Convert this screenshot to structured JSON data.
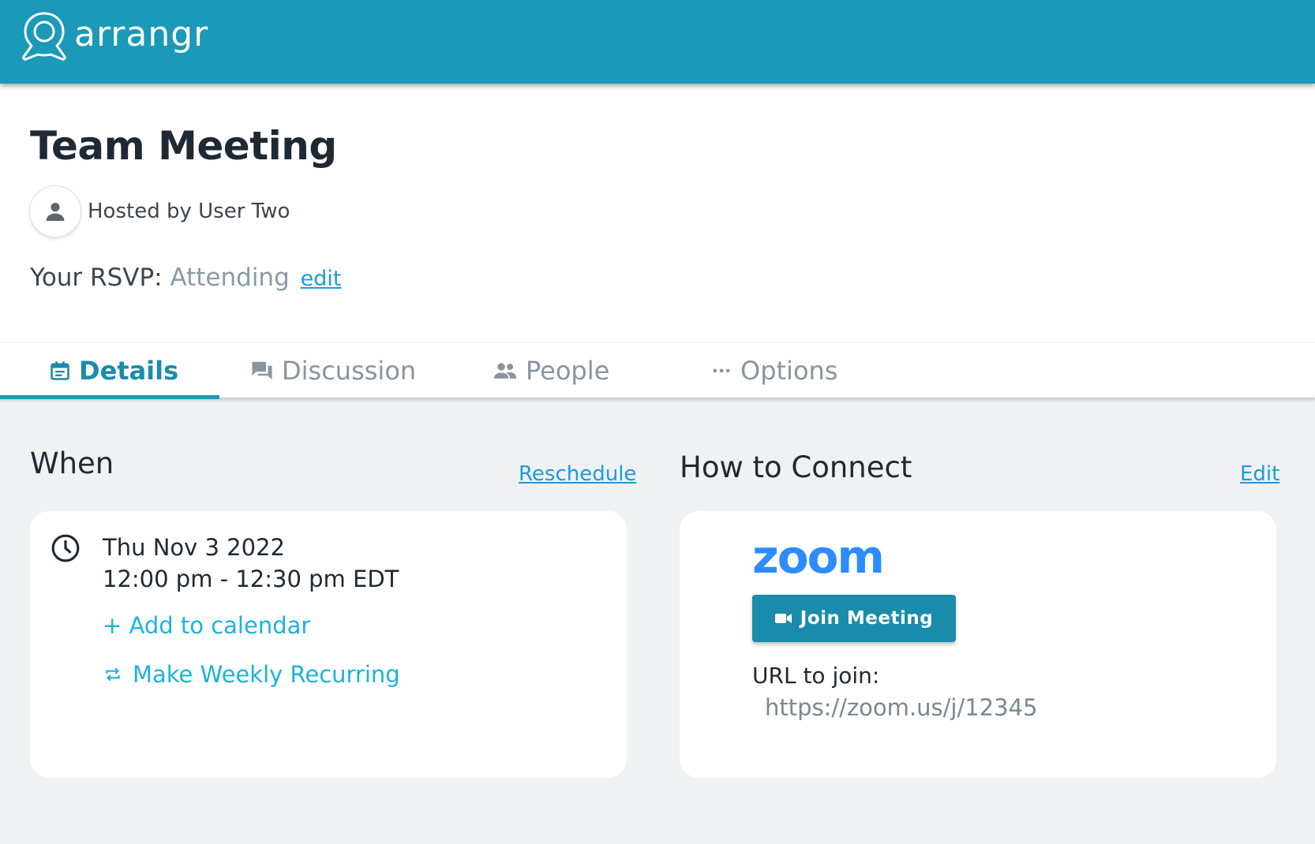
{
  "header": {
    "brand": "arrangr",
    "background": "#1a99b8"
  },
  "event": {
    "title": "Team Meeting",
    "host_text": "Hosted by User Two",
    "rsvp_label": "Your RSVP:",
    "rsvp_status": "Attending",
    "rsvp_edit": "edit"
  },
  "tabs": [
    {
      "label": "Details",
      "icon": "calendar-icon",
      "active": true
    },
    {
      "label": "Discussion",
      "icon": "chat-icon",
      "active": false
    },
    {
      "label": "People",
      "icon": "people-icon",
      "active": false
    },
    {
      "label": "Options",
      "icon": "more-horizontal-icon",
      "active": false
    }
  ],
  "when": {
    "title": "When",
    "action": "Reschedule",
    "date": "Thu Nov 3 2022",
    "time": "12:00 pm - 12:30 pm EDT",
    "add_calendar": "+ Add to calendar",
    "recurring": "Make Weekly Recurring"
  },
  "connect": {
    "title": "How to Connect",
    "action": "Edit",
    "provider_logo": "zoom",
    "join_button": "Join Meeting",
    "url_label": "URL to join:",
    "url": "https://zoom.us/j/12345"
  },
  "colors": {
    "accent": "#1a8bab",
    "link": "#1a9cd8",
    "zoom_blue": "#2d8cff"
  }
}
